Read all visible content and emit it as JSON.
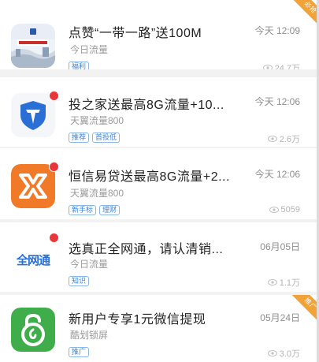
{
  "items": [
    {
      "title": "点赞“一带一路”送100M",
      "source": "今日流量",
      "tags": [
        "福利"
      ],
      "time": "今天 12:09",
      "views": "24.7万",
      "ribbon": "必抢",
      "icon": "one-belt-one-road-banner-icon",
      "has_dot": false
    },
    {
      "title": "投之家送最高8G流量+10...",
      "source": "天翼流量800",
      "tags": [
        "推荐",
        "首投低"
      ],
      "time": "今天 12:06",
      "views": "2.6万",
      "ribbon": "",
      "icon": "shield-v-logo-icon",
      "has_dot": true
    },
    {
      "title": "恒信易贷送最高8G流量+2...",
      "source": "天翼流量800",
      "tags": [
        "新手标",
        "理财"
      ],
      "time": "今天 12:06",
      "views": "5059",
      "ribbon": "",
      "icon": "hengxin-orange-logo-icon",
      "has_dot": true
    },
    {
      "title": "选真正全网通，请认清销...",
      "source": "今日流量",
      "tags": [
        "知识"
      ],
      "time": "06月05日",
      "views": "1.1万",
      "ribbon": "",
      "icon": "quanwangtong-logo-icon",
      "icon_text": "全网通",
      "has_dot": true
    },
    {
      "title": "新用户专享1元微信提现",
      "source": "酷划锁屏",
      "tags": [
        "推广"
      ],
      "time": "05月24日",
      "views": "3.0万",
      "ribbon": "推广",
      "icon": "green-unlock-logo-icon",
      "has_dot": false
    }
  ],
  "colors": {
    "tag_blue": "#3d84d6",
    "dot_red": "#e8373a",
    "ribbon_orange": "#f1a339",
    "hengxin_orange": "#f07a28",
    "unlock_green": "#3fae4a",
    "shield_blue": "#2a6fd6"
  }
}
